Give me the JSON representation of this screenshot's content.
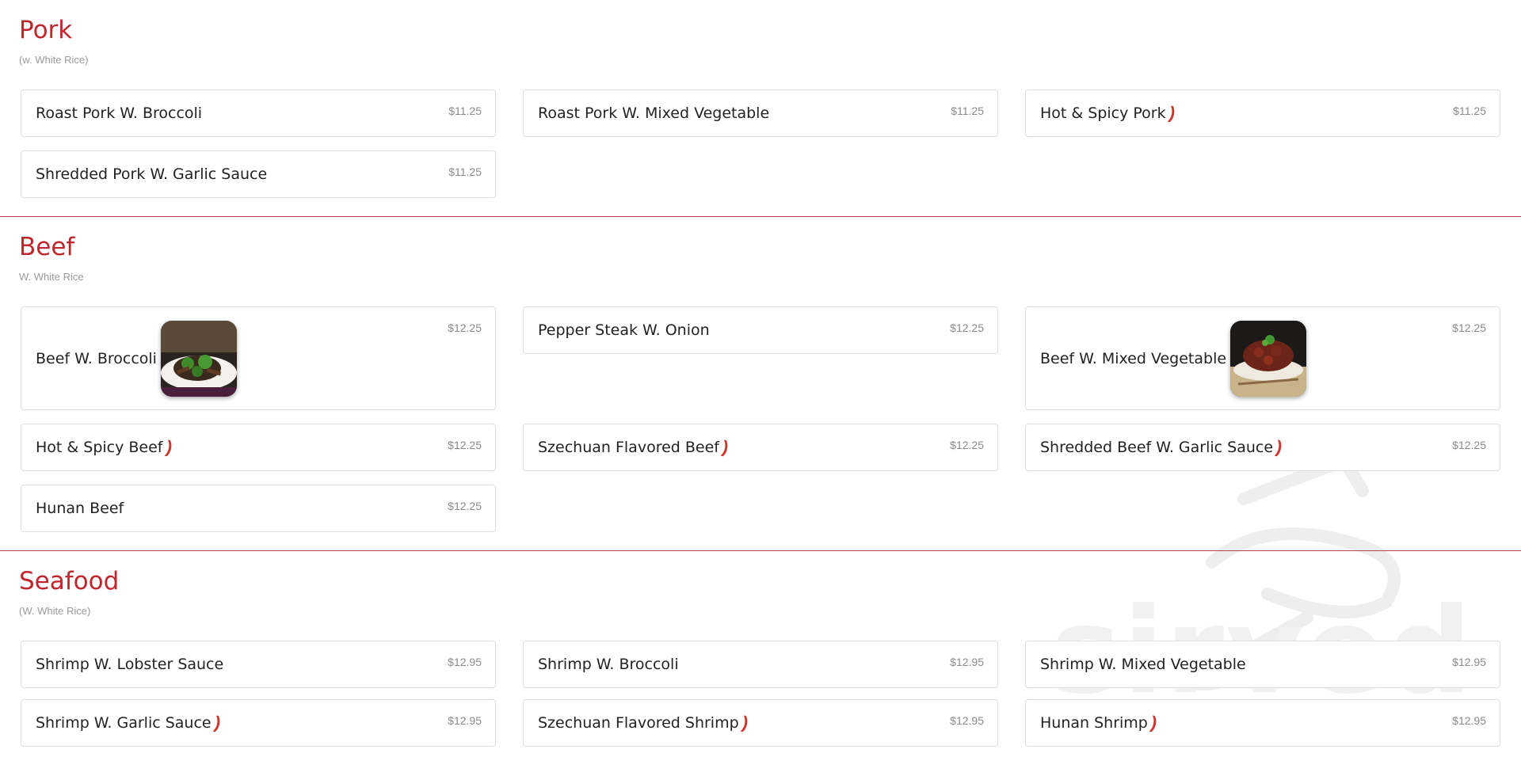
{
  "watermark": {
    "text": "sirved"
  },
  "categories": [
    {
      "title": "Pork",
      "subtitle": "(w. White Rice)",
      "items": [
        {
          "name": "Roast Pork W. Broccoli",
          "price": "$11.25"
        },
        {
          "name": "Roast Pork W. Mixed Vegetable",
          "price": "$11.25"
        },
        {
          "name": "Hot & Spicy Pork",
          "price": "$11.25",
          "spicy": true
        },
        {
          "name": "Shredded Pork W. Garlic Sauce",
          "price": "$11.25"
        }
      ]
    },
    {
      "title": "Beef",
      "subtitle": "W. White Rice",
      "items": [
        {
          "name": "Beef W. Broccoli",
          "price": "$12.25",
          "image": "beef-broccoli-photo"
        },
        {
          "name": "Pepper Steak W. Onion",
          "price": "$12.25"
        },
        {
          "name": "Beef W. Mixed Vegetable",
          "price": "$12.25",
          "image": "beef-mixed-vegetable-photo"
        },
        {
          "name": "Hot & Spicy Beef",
          "price": "$12.25",
          "spicy": true
        },
        {
          "name": "Szechuan Flavored Beef",
          "price": "$12.25",
          "spicy": true
        },
        {
          "name": "Shredded Beef W. Garlic Sauce",
          "price": "$12.25",
          "spicy": true
        },
        {
          "name": "Hunan Beef",
          "price": "$12.25"
        }
      ]
    },
    {
      "title": "Seafood",
      "subtitle": "(W. White Rice)",
      "items": [
        {
          "name": "Shrimp W. Lobster Sauce",
          "price": "$12.95"
        },
        {
          "name": "Shrimp W. Broccoli",
          "price": "$12.95"
        },
        {
          "name": "Shrimp W. Mixed Vegetable",
          "price": "$12.95"
        },
        {
          "name": "Shrimp W. Garlic Sauce",
          "price": "$12.95",
          "spicy": true
        },
        {
          "name": "Szechuan Flavored Shrimp",
          "price": "$12.95",
          "spicy": true
        },
        {
          "name": "Hunan Shrimp",
          "price": "$12.95",
          "spicy": true
        }
      ]
    }
  ]
}
